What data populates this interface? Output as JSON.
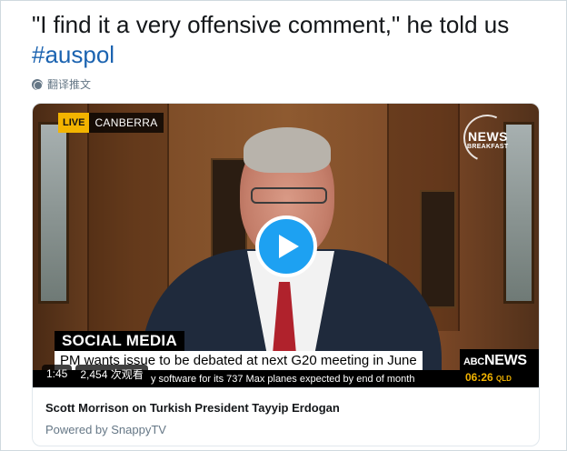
{
  "tweet": {
    "text_prefix": "\"I find it a very offensive comment,\" he told us ",
    "hashtag": "#auspol",
    "translate_label": "翻译推文"
  },
  "video": {
    "live_label": "LIVE",
    "location": "CANBERRA",
    "logo_news": "NEWS",
    "logo_breakfast": "BREAKFAST",
    "segment_label": "SOCIAL MEDIA",
    "headline": "PM wants issue to be debated at next G20 meeting in June",
    "ticker": "y software for its 737 Max planes expected by end of month",
    "channel": "NEWS",
    "channel_prefix": "ABC",
    "time": "06:26",
    "timezone": "QLD",
    "duration": "1:45",
    "views": "2,454 次观看",
    "play_state": "paused"
  },
  "card": {
    "title": "Scott Morrison on Turkish President Tayyip Erdogan",
    "source": "Powered by SnappyTV"
  }
}
